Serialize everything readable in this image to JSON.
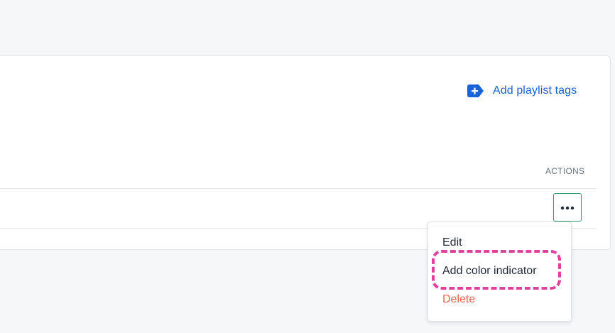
{
  "header": {
    "add_tags_label": "Add playlist tags",
    "add_tags_icon": "tag-plus-icon"
  },
  "table": {
    "actions_header": "ACTIONS",
    "row": {
      "more_button_icon": "more-horizontal-icon"
    }
  },
  "menu": {
    "items": [
      {
        "label": "Edit"
      },
      {
        "label": "Add color indicator",
        "highlighted": true
      },
      {
        "label": "Delete",
        "color": "#ee6452"
      }
    ]
  },
  "colors": {
    "accent_blue": "#1a63d6",
    "button_border_green": "#2d9b70",
    "delete_red": "#ee6452",
    "highlight_pink": "#e0409e",
    "background": "#f6f7f9"
  }
}
